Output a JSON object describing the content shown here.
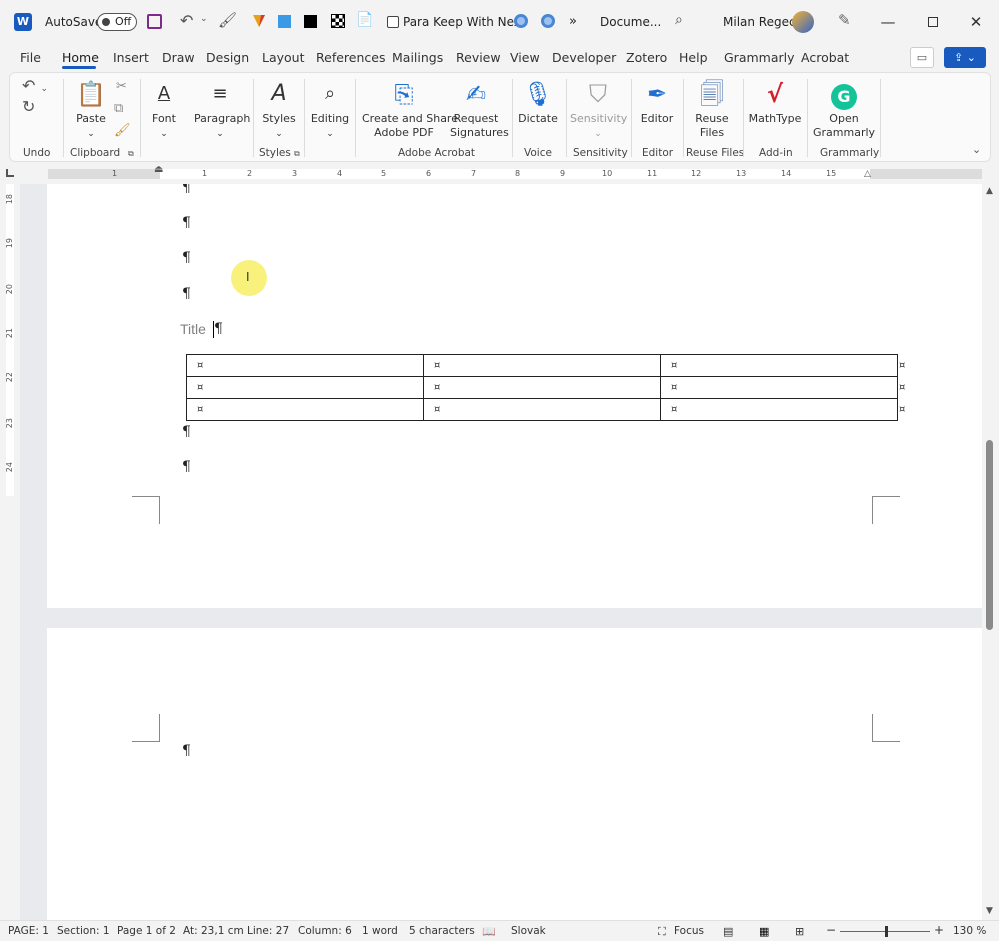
{
  "titlebar": {
    "autosave_label": "AutoSave",
    "autosave_state": "Off",
    "para_keep_label": "Para Keep With Next",
    "more_label": "»",
    "doc_name": "Docume...",
    "user_name": "Milan Regec"
  },
  "menu": [
    "File",
    "Home",
    "Insert",
    "Draw",
    "Design",
    "Layout",
    "References",
    "Mailings",
    "Review",
    "View",
    "Developer",
    "Zotero",
    "Help",
    "Grammarly",
    "Acrobat"
  ],
  "ribbon": {
    "groups": {
      "undo": "Undo",
      "clipboard": "Clipboard",
      "styles": "Styles",
      "adobe": "Adobe Acrobat",
      "voice": "Voice",
      "sensitivity": "Sensitivity",
      "editor": "Editor",
      "reuse": "Reuse Files",
      "addin": "Add-in",
      "grammarly": "Grammarly"
    },
    "buttons": {
      "paste": "Paste",
      "font": "Font",
      "paragraph": "Paragraph",
      "styles": "Styles",
      "editing": "Editing",
      "create_share_1": "Create and Share",
      "create_share_2": "Adobe PDF",
      "request_1": "Request",
      "request_2": "Signatures",
      "dictate": "Dictate",
      "sensitivity": "Sensitivity",
      "editor": "Editor",
      "reuse_1": "Reuse",
      "reuse_2": "Files",
      "mathtype": "MathType",
      "open_1": "Open",
      "open_2": "Grammarly"
    }
  },
  "ruler": {
    "h_ticks": [
      "1",
      "1",
      "2",
      "3",
      "4",
      "5",
      "6",
      "7",
      "8",
      "9",
      "10",
      "11",
      "12",
      "13",
      "14",
      "15"
    ],
    "v_ticks": [
      "18",
      "19",
      "20",
      "21",
      "22",
      "23",
      "24"
    ]
  },
  "document": {
    "pilcrow": "¶",
    "title_text": "Title",
    "cell_mark": "¤"
  },
  "status": {
    "page": "PAGE: 1",
    "section": "Section: 1",
    "page_of": "Page 1 of 2",
    "at": "At: 23,1 cm",
    "line": "Line: 27",
    "column": "Column: 6",
    "words": "1 word",
    "chars": "5 characters",
    "language": "Slovak",
    "focus": "Focus",
    "zoom": "130 %",
    "zoom_minus": "−",
    "zoom_plus": "+"
  }
}
